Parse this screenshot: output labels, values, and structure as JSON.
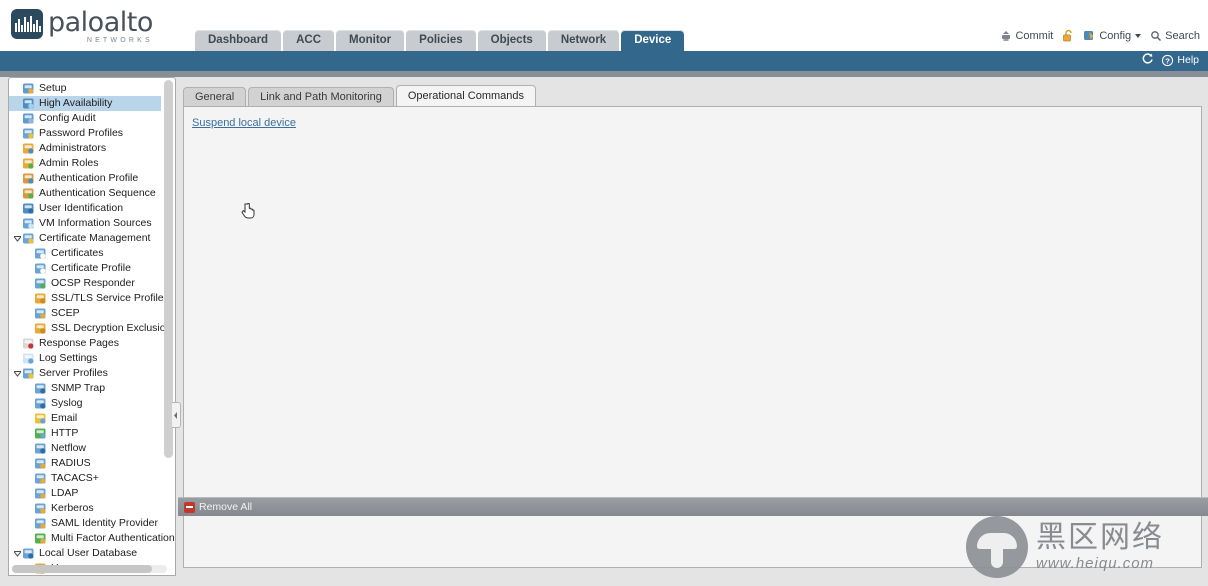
{
  "brand": {
    "name": "paloalto",
    "tagline": "NETWORKS"
  },
  "header": {
    "tabs": [
      {
        "label": "Dashboard",
        "active": false
      },
      {
        "label": "ACC",
        "active": false
      },
      {
        "label": "Monitor",
        "active": false
      },
      {
        "label": "Policies",
        "active": false
      },
      {
        "label": "Objects",
        "active": false
      },
      {
        "label": "Network",
        "active": false
      },
      {
        "label": "Device",
        "active": true
      }
    ],
    "actions": [
      {
        "label": "Commit",
        "icon": "commit-icon"
      },
      {
        "label": "",
        "icon": "unlock-icon"
      },
      {
        "label": "Config",
        "icon": "config-icon",
        "caret": true
      },
      {
        "label": "Search",
        "icon": "search-icon"
      }
    ],
    "bluebar": [
      {
        "label": "",
        "icon": "refresh-icon"
      },
      {
        "label": "Help",
        "icon": "help-icon"
      }
    ]
  },
  "sidebar": {
    "items": [
      {
        "label": "Setup",
        "indent": 0,
        "icon": "setup-icon",
        "selected": false,
        "expander": ""
      },
      {
        "label": "High Availability",
        "indent": 0,
        "icon": "ha-icon",
        "selected": true,
        "expander": ""
      },
      {
        "label": "Config Audit",
        "indent": 0,
        "icon": "config-audit-icon",
        "selected": false,
        "expander": ""
      },
      {
        "label": "Password Profiles",
        "indent": 0,
        "icon": "password-profiles-icon",
        "selected": false,
        "expander": ""
      },
      {
        "label": "Administrators",
        "indent": 0,
        "icon": "administrators-icon",
        "selected": false,
        "expander": ""
      },
      {
        "label": "Admin Roles",
        "indent": 0,
        "icon": "admin-roles-icon",
        "selected": false,
        "expander": ""
      },
      {
        "label": "Authentication Profile",
        "indent": 0,
        "icon": "auth-profile-icon",
        "selected": false,
        "expander": ""
      },
      {
        "label": "Authentication Sequence",
        "indent": 0,
        "icon": "auth-sequence-icon",
        "selected": false,
        "expander": ""
      },
      {
        "label": "User Identification",
        "indent": 0,
        "icon": "user-identification-icon",
        "selected": false,
        "expander": ""
      },
      {
        "label": "VM Information Sources",
        "indent": 0,
        "icon": "vm-info-sources-icon",
        "selected": false,
        "expander": ""
      },
      {
        "label": "Certificate Management",
        "indent": 0,
        "icon": "certificate-management-icon",
        "selected": false,
        "expander": "expanded"
      },
      {
        "label": "Certificates",
        "indent": 1,
        "icon": "certificates-icon",
        "selected": false,
        "expander": ""
      },
      {
        "label": "Certificate Profile",
        "indent": 1,
        "icon": "certificate-profile-icon",
        "selected": false,
        "expander": ""
      },
      {
        "label": "OCSP Responder",
        "indent": 1,
        "icon": "ocsp-responder-icon",
        "selected": false,
        "expander": ""
      },
      {
        "label": "SSL/TLS Service Profile",
        "indent": 1,
        "icon": "ssl-tls-service-profile-icon",
        "selected": false,
        "expander": ""
      },
      {
        "label": "SCEP",
        "indent": 1,
        "icon": "scep-icon",
        "selected": false,
        "expander": ""
      },
      {
        "label": "SSL Decryption Exclusion",
        "indent": 1,
        "icon": "ssl-decryption-exclusion-icon",
        "selected": false,
        "expander": ""
      },
      {
        "label": "Response Pages",
        "indent": 0,
        "icon": "response-pages-icon",
        "selected": false,
        "expander": ""
      },
      {
        "label": "Log Settings",
        "indent": 0,
        "icon": "log-settings-icon",
        "selected": false,
        "expander": ""
      },
      {
        "label": "Server Profiles",
        "indent": 0,
        "icon": "server-profiles-icon",
        "selected": false,
        "expander": "expanded"
      },
      {
        "label": "SNMP Trap",
        "indent": 1,
        "icon": "snmp-trap-icon",
        "selected": false,
        "expander": ""
      },
      {
        "label": "Syslog",
        "indent": 1,
        "icon": "syslog-icon",
        "selected": false,
        "expander": ""
      },
      {
        "label": "Email",
        "indent": 1,
        "icon": "email-icon",
        "selected": false,
        "expander": ""
      },
      {
        "label": "HTTP",
        "indent": 1,
        "icon": "http-icon",
        "selected": false,
        "expander": ""
      },
      {
        "label": "Netflow",
        "indent": 1,
        "icon": "netflow-icon",
        "selected": false,
        "expander": ""
      },
      {
        "label": "RADIUS",
        "indent": 1,
        "icon": "radius-icon",
        "selected": false,
        "expander": ""
      },
      {
        "label": "TACACS+",
        "indent": 1,
        "icon": "tacacs-icon",
        "selected": false,
        "expander": ""
      },
      {
        "label": "LDAP",
        "indent": 1,
        "icon": "ldap-icon",
        "selected": false,
        "expander": ""
      },
      {
        "label": "Kerberos",
        "indent": 1,
        "icon": "kerberos-icon",
        "selected": false,
        "expander": ""
      },
      {
        "label": "SAML Identity Provider",
        "indent": 1,
        "icon": "saml-identity-provider-icon",
        "selected": false,
        "expander": ""
      },
      {
        "label": "Multi Factor Authentication",
        "indent": 1,
        "icon": "multi-factor-auth-icon",
        "selected": false,
        "expander": ""
      },
      {
        "label": "Local User Database",
        "indent": 0,
        "icon": "local-user-database-icon",
        "selected": false,
        "expander": "expanded"
      },
      {
        "label": "Users",
        "indent": 1,
        "icon": "users-icon",
        "selected": false,
        "expander": ""
      }
    ]
  },
  "content": {
    "subtabs": [
      {
        "label": "General",
        "active": false
      },
      {
        "label": "Link and Path Monitoring",
        "active": false
      },
      {
        "label": "Operational Commands",
        "active": true
      }
    ],
    "suspend_link": "Suspend local device"
  },
  "bottombar": {
    "remove_all": "Remove All"
  },
  "watermark": {
    "cn_text": "黑区网络",
    "url_text": "www.heiqu.com"
  },
  "colors": {
    "accent_blue": "#33678c",
    "selection_blue": "#b9d5ea",
    "link_blue": "#3b6f9e",
    "body_gray": "#e4e4e4",
    "panel_gray": "#f4f4f4",
    "band_gray": "#888e96"
  }
}
